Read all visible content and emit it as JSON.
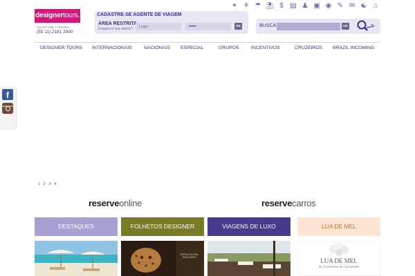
{
  "brand": {
    "logo_bold": "designer",
    "logo_light": "tours.",
    "phone_label": "TELEFONE / PHONE",
    "phone_number": "(55 11) 2181 2900",
    "accent": "#d8157a",
    "primary": "#3a2f8a"
  },
  "top_icons": [
    "handshake-icon",
    "palm-tree-icon",
    "parachute-icon",
    "umbrella-icon",
    "dollar-icon",
    "document-icon",
    "person-icon",
    "facebook-icon",
    "globe-icon",
    "pen-icon",
    "mail-icon",
    "people-icon",
    "home-icon"
  ],
  "agent": {
    "register_link": "CADASTRE-SE AGENTE DE VIAGEM",
    "area_title": "ÁREA RESTRITA",
    "forgot_password": "Esqueceu sua senha?",
    "login_placeholder": "Login",
    "password_value": "•••••",
    "ok_label": "OK"
  },
  "search": {
    "label": "BUSCA",
    "placeholder": "",
    "ok_label": "OK"
  },
  "nav": [
    "DESIGNER TOURS",
    "INTERNACIONAIS",
    "NACIONAIS",
    "ESPECIAL",
    "GRUPOS",
    "INCENTIVOS",
    "CRUZEIROS",
    "BRAZIL INCOMING"
  ],
  "pager": [
    "1",
    "2",
    "3",
    "4"
  ],
  "reserve": {
    "online": {
      "bold": "reserve",
      "light": "online"
    },
    "cars": {
      "bold": "reserve",
      "light": "carros"
    }
  },
  "tiles": [
    {
      "label": "DESTAQUES",
      "bg": "#a99fd2",
      "fg": "#ffffff"
    },
    {
      "label": "FOLHETOS DESIGNER",
      "bg": "#7a7b26",
      "fg": "#ffffff"
    },
    {
      "label": "VIAGENS DE LUXO",
      "bg": "#4a3a8c",
      "fg": "#ffffff"
    },
    {
      "label": "LUA DE MEL",
      "bg": "#fbe4d2",
      "fg": "#c0742e"
    }
  ],
  "tile_images": {
    "folhetos_caption": "ÁFRICA DO SUL EXCLUSIVO",
    "lua_title": "LUA DE MEL",
    "lua_subtitle": "& Cerimônias de Casamento"
  }
}
